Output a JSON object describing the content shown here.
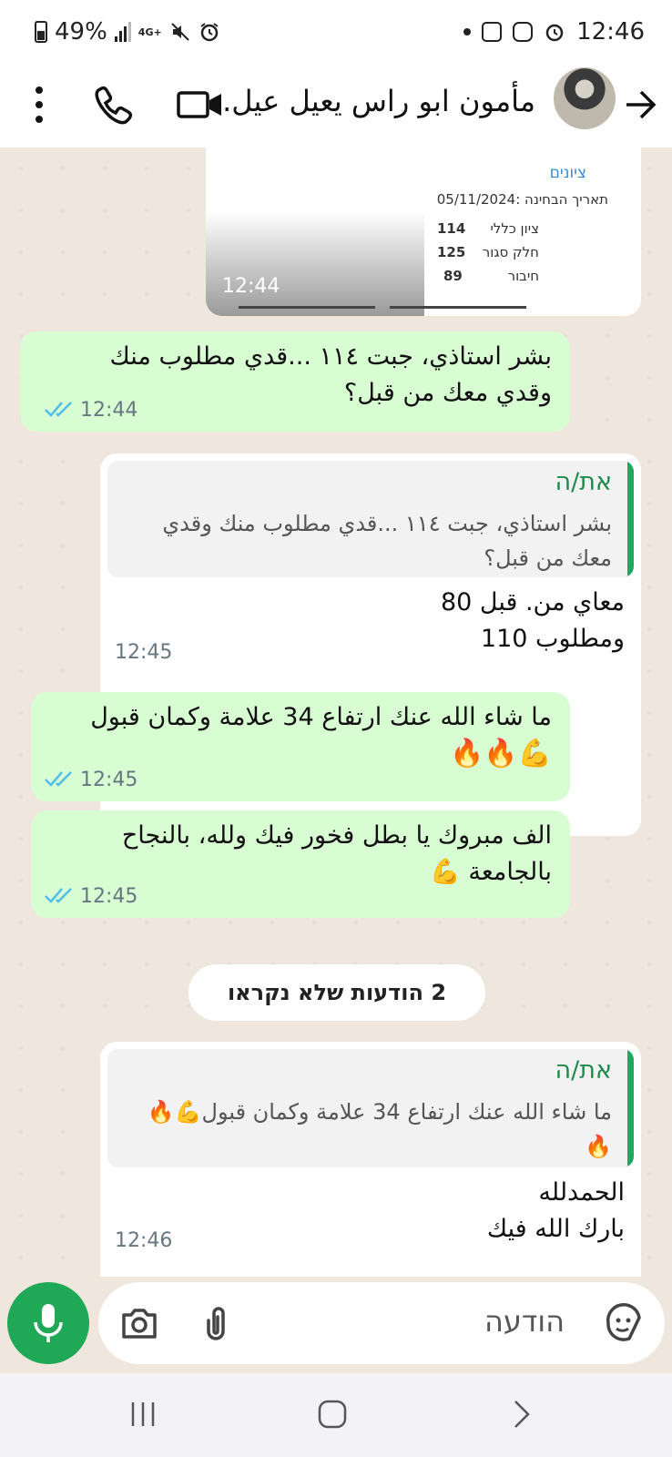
{
  "status_bar": {
    "battery": "49%",
    "network": "4G+",
    "time": "12:46"
  },
  "header": {
    "contact_name": "مأمون ابو راس يعيل عيل.."
  },
  "image_message": {
    "doc_title": "ציונים",
    "doc_date": "תאריך הבחינה :05/11/2024",
    "rows": [
      {
        "label": "ציון כללי",
        "value": "114"
      },
      {
        "label": "חלק סגור",
        "value": "125"
      },
      {
        "label": "חיבור",
        "value": "89"
      }
    ],
    "time": "12:44"
  },
  "messages": [
    {
      "text_line1": "بشر استاذي، جبت ١١٤ ...قدي مطلوب منك",
      "text_line2": "وقدي معك من قبل؟",
      "time": "12:44"
    },
    {
      "quote_author": "את/ה",
      "quote_line1": "بشر استاذي، جبت ١١٤ ...قدي مطلوب منك وقدي",
      "quote_line2": "معك من قبل؟",
      "text_line1": "معاي من. قبل 80",
      "text_line2": "ومطلوب 110",
      "time": "12:45"
    },
    {
      "text_line1": "ما شاء الله عنك ارتفاع 34 علامة وكمان قبول",
      "emoji_line": "💪🔥🔥",
      "time": "12:45"
    },
    {
      "text_line1": "الف مبروك يا بطل فخور فيك ولله، بالنجاح",
      "text_line2": "بالجامعة 💪",
      "time": "12:45"
    },
    {
      "quote_author": "את/ה",
      "quote_line1": "ما شاء الله عنك ارتفاع 34 علامة وكمان قبول💪🔥",
      "quote_line2": "🔥",
      "text_line1": "الحمدلله",
      "text_line2": "بارك الله فيك",
      "time": "12:46"
    }
  ],
  "unread_separator": "2 הודעות שלא נקראו",
  "input": {
    "placeholder": "הודעה"
  },
  "colors": {
    "outgoing_bubble": "#d9fdd3",
    "incoming_bubble": "#ffffff",
    "accent_green": "#1fa855",
    "read_ticks": "#53bdeb"
  },
  "icons": [
    "menu-icon",
    "phone-icon",
    "video-icon",
    "back-arrow-icon",
    "camera-icon",
    "attach-icon",
    "sticker-icon",
    "mic-icon",
    "read-ticks-icon"
  ]
}
